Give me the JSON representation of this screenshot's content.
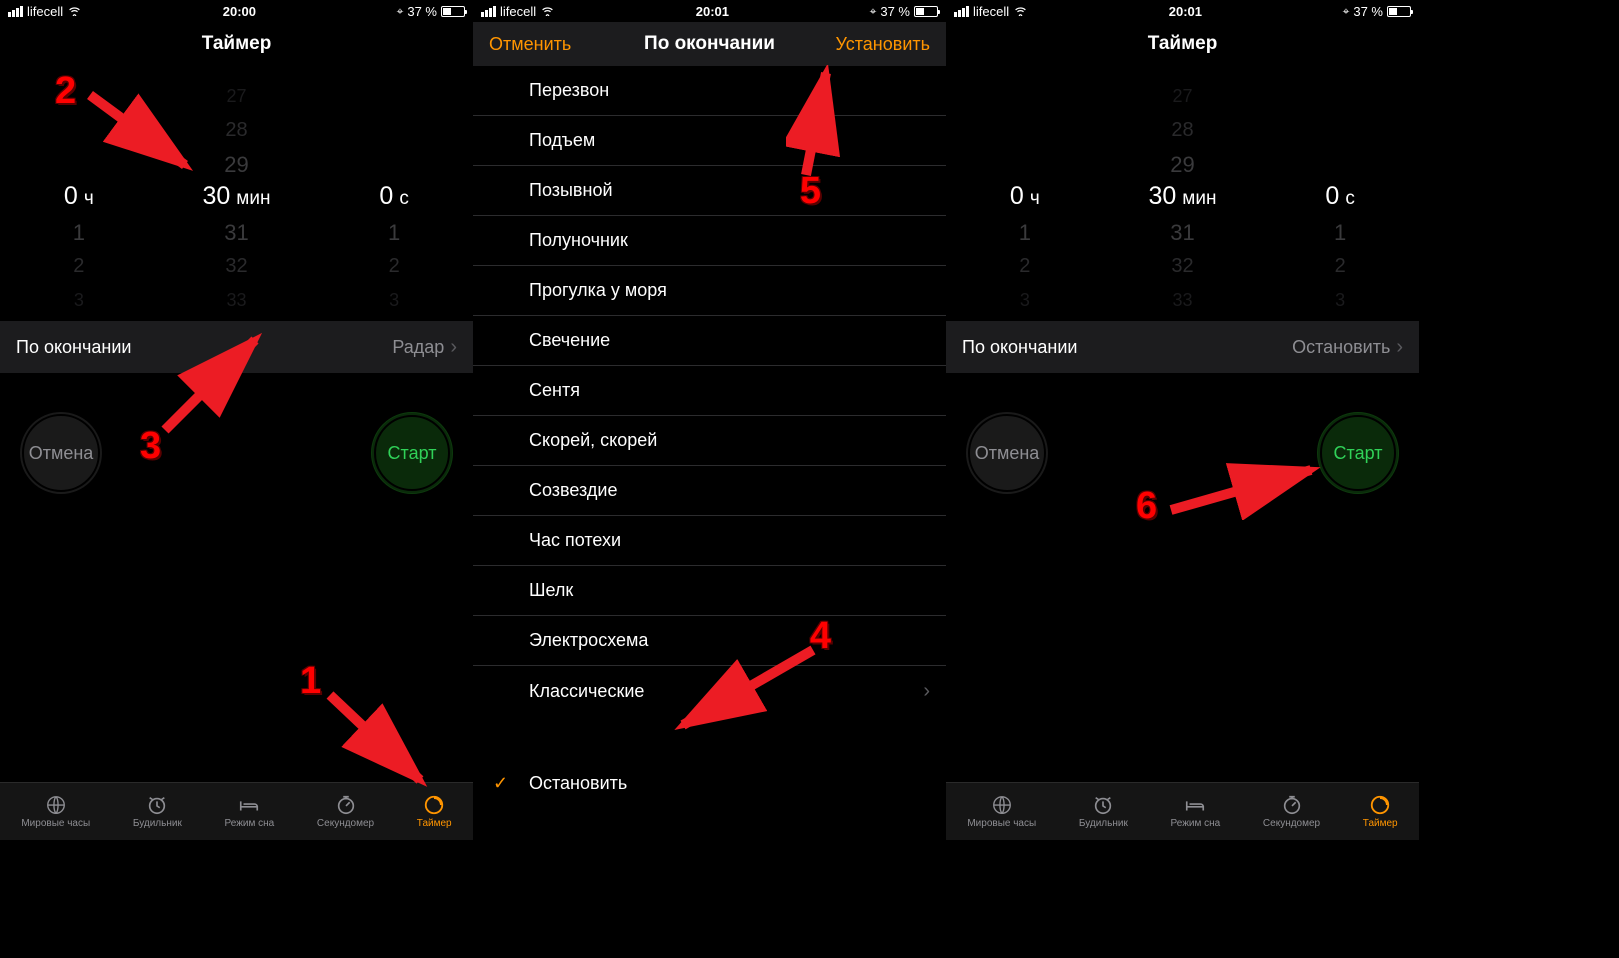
{
  "status": {
    "carrier": "lifecell",
    "time1": "20:00",
    "time2": "20:01",
    "battery_pct": "37 %",
    "nav_indicator": "⌖"
  },
  "screen1": {
    "title": "Таймер",
    "picker": {
      "h_value": "0",
      "h_unit": "ч",
      "m_value": "30",
      "m_unit": "мин",
      "s_value": "0",
      "s_unit": "с",
      "m_above": [
        "27",
        "28",
        "29"
      ],
      "m_below": [
        "31",
        "32",
        "33"
      ],
      "hs_below": [
        "1",
        "2",
        "3"
      ]
    },
    "whenends_label": "По окончании",
    "whenends_value": "Радар",
    "cancel": "Отмена",
    "start": "Старт"
  },
  "screen2": {
    "nav_left": "Отменить",
    "nav_title": "По окончании",
    "nav_right": "Установить",
    "sounds": [
      "Перезвон",
      "Подъем",
      "Позывной",
      "Полуночник",
      "Прогулка у моря",
      "Свечение",
      "Сентя",
      "Скорей, скорей",
      "Созвездие",
      "Час потехи",
      "Шелк",
      "Электросхема"
    ],
    "classic_label": "Классические",
    "stop_label": "Остановить"
  },
  "screen3": {
    "title": "Таймер",
    "whenends_label": "По окончании",
    "whenends_value": "Остановить",
    "cancel": "Отмена",
    "start": "Старт"
  },
  "tabs": {
    "world": "Мировые часы",
    "alarm": "Будильник",
    "sleep": "Режим сна",
    "stopwatch": "Секундомер",
    "timer": "Таймер"
  },
  "annotations": {
    "n1": "1",
    "n2": "2",
    "n3": "3",
    "n4": "4",
    "n5": "5",
    "n6": "6"
  }
}
